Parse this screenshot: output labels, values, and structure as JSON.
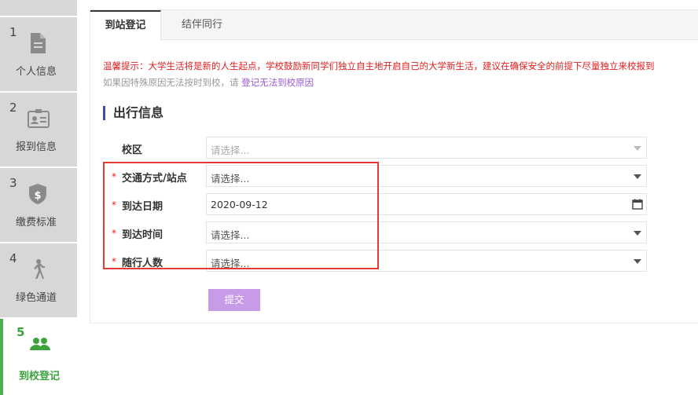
{
  "steps": [
    {
      "number": "1",
      "label": "个人信息",
      "icon": "document-icon"
    },
    {
      "number": "2",
      "label": "报到信息",
      "icon": "id-card-icon"
    },
    {
      "number": "3",
      "label": "缴费标准",
      "icon": "dollar-shield-icon"
    },
    {
      "number": "4",
      "label": "绿色通道",
      "icon": "walking-person-icon"
    },
    {
      "number": "5",
      "label": "到校登记",
      "icon": "people-icon"
    }
  ],
  "active_step_color": "#3ca33c",
  "tabs": [
    "到站登记",
    "结伴同行"
  ],
  "notice": {
    "line1": "温馨提示：大学生活将是新的人生起点，学校鼓励新同学们独立自主地开启自己的大学新生活，建议在确保安全的前提下尽量独立来校报到",
    "line2_prefix": "如果因特殊原因无法按时到校，请",
    "line2_link": "登记无法到校原因"
  },
  "section_title": "出行信息",
  "form": {
    "campus": {
      "label": "校区",
      "value": "请选择..."
    },
    "transport": {
      "label": "交通方式/站点",
      "value": "请选择..."
    },
    "arrival_date": {
      "label": "到达日期",
      "value": "2020-09-12"
    },
    "arrival_time": {
      "label": "到达时间",
      "value": "请选择..."
    },
    "companions": {
      "label": "随行人数",
      "value": "请选择..."
    },
    "required_mark": "*"
  },
  "submit_label": "提交",
  "colors": {
    "notice_red": "#e02020",
    "link_purple": "#9a5ad8",
    "submit_bg": "#c79be8",
    "highlight_border": "#e53935",
    "section_accent": "#3b4da8"
  }
}
